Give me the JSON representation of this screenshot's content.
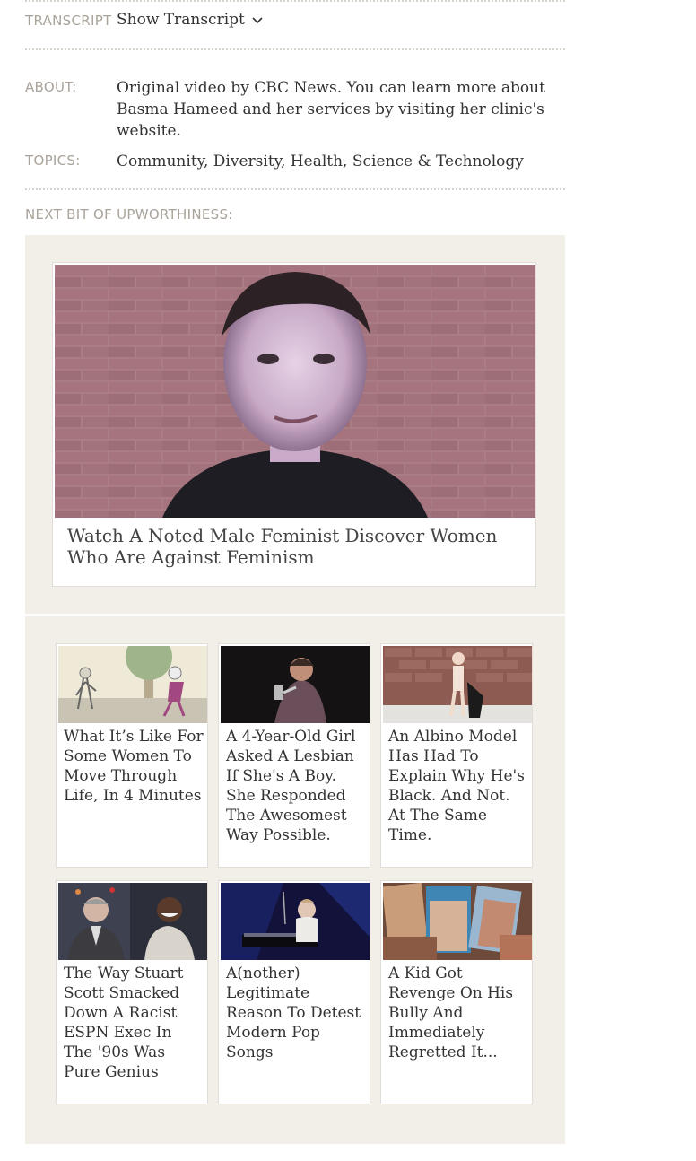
{
  "transcript": {
    "label": "TRANSCRIPT",
    "link": "Show Transcript",
    "icon": "chevron-down-icon"
  },
  "about": {
    "label": "ABOUT:",
    "text": "Original video by CBC News. You can learn more about Basma Hameed and her services by visiting her clinic's website."
  },
  "topics": {
    "label": "TOPICS:",
    "text": "Community, Diversity, Health, Science & Technology"
  },
  "next": {
    "label": "NEXT BIT OF UPWORTHINESS:",
    "featured": {
      "title": "Watch A Noted Male Feminist Discover Women Who Are Against Feminism"
    },
    "grid": [
      {
        "title": "What It’s Like For Some Women To Move Through Life, In 4 Minutes"
      },
      {
        "title": "A 4-Year-Old Girl Asked A Lesbian If She's A Boy. She Responded The Awesomest Way Possible."
      },
      {
        "title": "An Albino Model Has Had To Explain Why He's Black. And Not. At The Same Time."
      },
      {
        "title": "The Way Stuart Scott Smacked Down A Racist ESPN Exec In The '90s Was Pure Genius"
      },
      {
        "title": "A(nother) Legitimate Reason To Detest Modern Pop Songs"
      },
      {
        "title": "A Kid Got Revenge On His Bully And Immediately Regretted It..."
      }
    ]
  },
  "colors": {
    "panel_bg": "#f2efe9",
    "label": "#a9a39a",
    "text": "#333333"
  }
}
